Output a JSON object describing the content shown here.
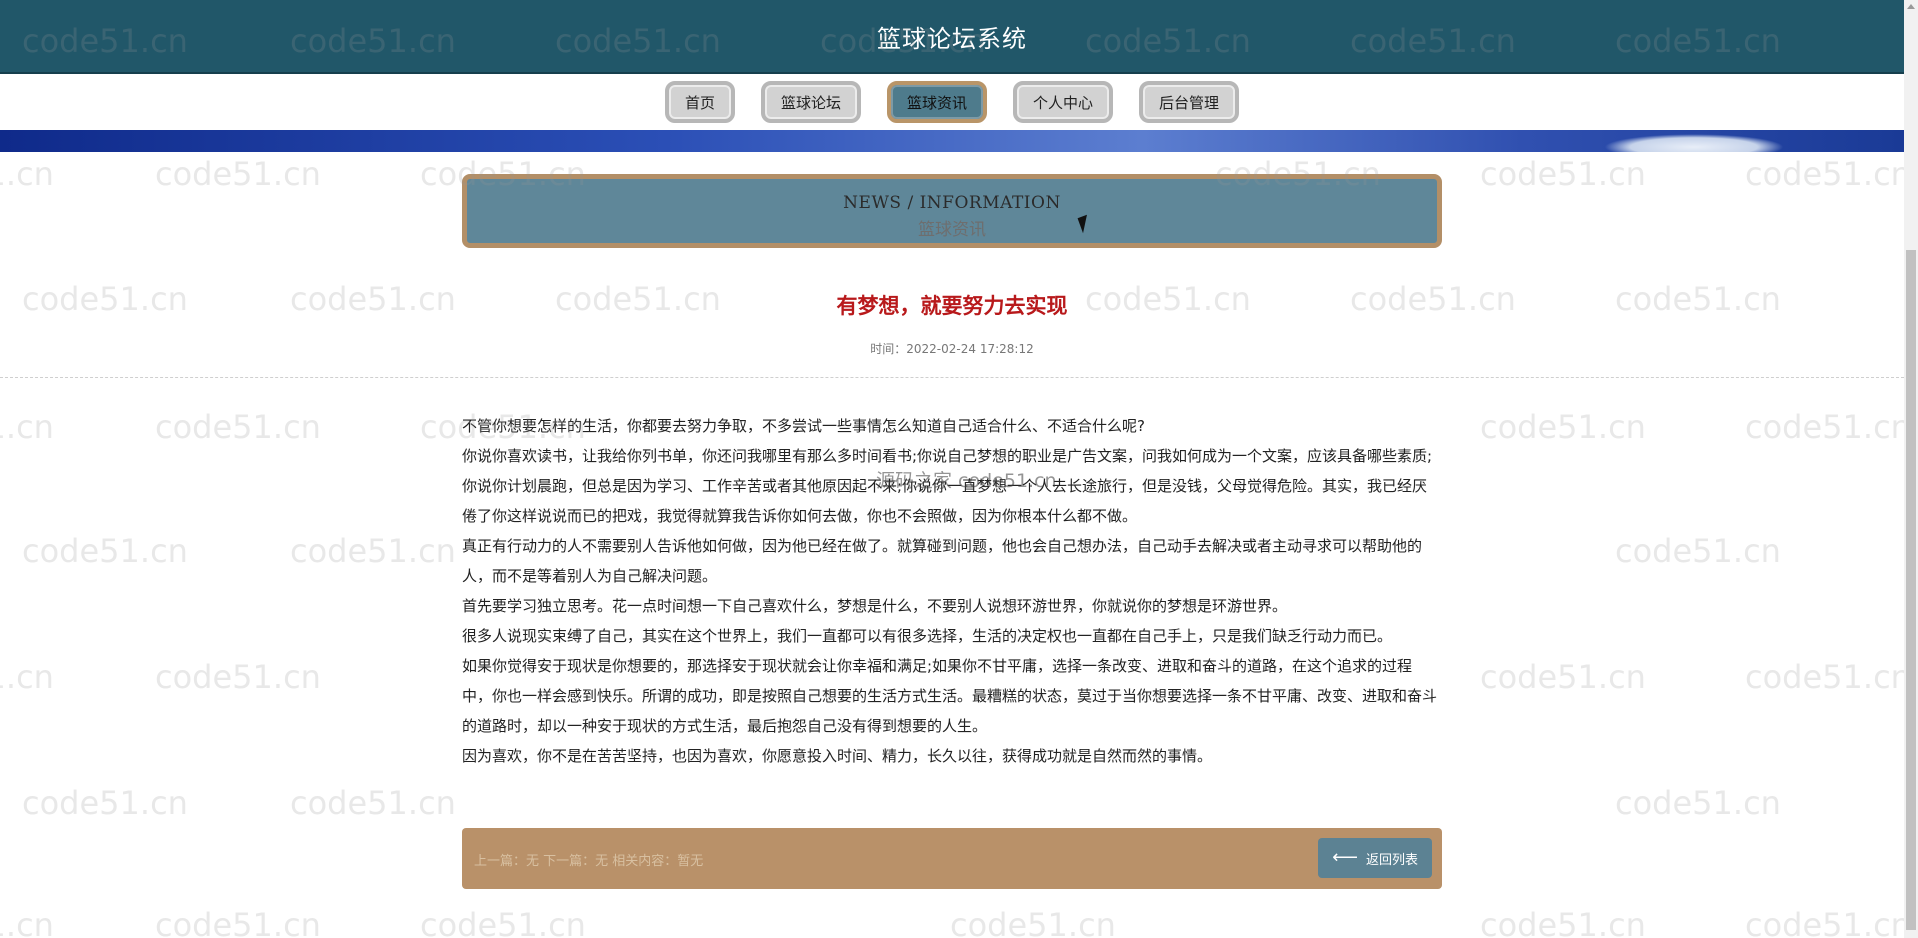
{
  "header": {
    "title": "篮球论坛系统"
  },
  "nav": {
    "items": [
      {
        "label": "首页",
        "active": false
      },
      {
        "label": "篮球论坛",
        "active": false
      },
      {
        "label": "篮球资讯",
        "active": true
      },
      {
        "label": "个人中心",
        "active": false
      },
      {
        "label": "后台管理",
        "active": false
      }
    ]
  },
  "section": {
    "en": "NEWS / INFORMATION",
    "cn": "篮球资讯"
  },
  "article": {
    "title": "有梦想，就要努力去实现",
    "time": "时间：2022-02-24 17:28:12",
    "paragraphs": [
      "不管你想要怎样的生活，你都要去努力争取，不多尝试一些事情怎么知道自己适合什么、不适合什么呢?",
      "你说你喜欢读书，让我给你列书单，你还问我哪里有那么多时间看书;你说自己梦想的职业是广告文案，问我如何成为一个文案，应该具备哪些素质;你说你计划晨跑，但总是因为学习、工作辛苦或者其他原因起不来;你说你一直梦想一个人去长途旅行，但是没钱，父母觉得危险。其实，我已经厌倦了你这样说说而已的把戏，我觉得就算我告诉你如何去做，你也不会照做，因为你根本什么都不做。",
      "真正有行动力的人不需要别人告诉他如何做，因为他已经在做了。就算碰到问题，他也会自己想办法，自己动手去解决或者主动寻求可以帮助他的人，而不是等着别人为自己解决问题。",
      "首先要学习独立思考。花一点时间想一下自己喜欢什么，梦想是什么，不要别人说想环游世界，你就说你的梦想是环游世界。",
      "很多人说现实束缚了自己，其实在这个世界上，我们一直都可以有很多选择，生活的决定权也一直都在自己手上，只是我们缺乏行动力而已。",
      "如果你觉得安于现状是你想要的，那选择安于现状就会让你幸福和满足;如果你不甘平庸，选择一条改变、进取和奋斗的道路，在这个追求的过程中，你也一样会感到快乐。所谓的成功，即是按照自己想要的生活方式生活。最糟糕的状态，莫过于当你想要选择一条不甘平庸、改变、进取和奋斗的道路时，却以一种安于现状的方式生活，最后抱怨自己没有得到想要的人生。",
      "因为喜欢，你不是在苦苦坚持，也因为喜欢，你愿意投入时间、精力，长久以往，获得成功就是自然而然的事情。"
    ]
  },
  "footer": {
    "prevnext": "上一篇：无 下一篇：无 相关内容：暂无",
    "back_label": "返回列表"
  },
  "watermark": {
    "text": "code51.cn",
    "center_text": "源码之家 code51.cn"
  },
  "colors": {
    "header_bg": "#215769",
    "nav_active_bg": "#4e7b8c",
    "section_bg": "#5f8799",
    "section_border": "#b38f67",
    "title_red": "#b8191b",
    "footer_bg": "#b99169"
  }
}
